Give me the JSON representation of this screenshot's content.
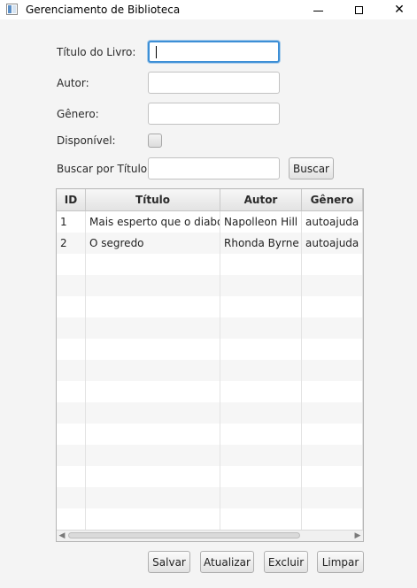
{
  "window": {
    "title": "Gerenciamento de Biblioteca",
    "controls": {
      "minimize": "minimize-icon",
      "maximize": "maximize-icon",
      "close": "✕"
    }
  },
  "form": {
    "titulo_label": "Título do Livro:",
    "titulo_value": "",
    "autor_label": "Autor:",
    "autor_value": "",
    "genero_label": "Gênero:",
    "genero_value": "",
    "disponivel_label": "Disponível:",
    "disponivel_checked": false,
    "buscar_label": "Buscar por Título:",
    "buscar_value": "",
    "buscar_button": "Buscar"
  },
  "table": {
    "columns": [
      "ID",
      "Título",
      "Autor",
      "Gênero"
    ],
    "rows": [
      [
        "1",
        "Mais esperto que o diabo",
        "Napolleon Hill",
        "autoajuda"
      ],
      [
        "2",
        "O segredo",
        "Rhonda Byrne",
        "autoajuda"
      ]
    ]
  },
  "actions": {
    "salvar": "Salvar",
    "atualizar": "Atualizar",
    "excluir": "Excluir",
    "limpar": "Limpar"
  },
  "colors": {
    "focus": "#3d8fd6",
    "background": "#f4f4f4"
  }
}
